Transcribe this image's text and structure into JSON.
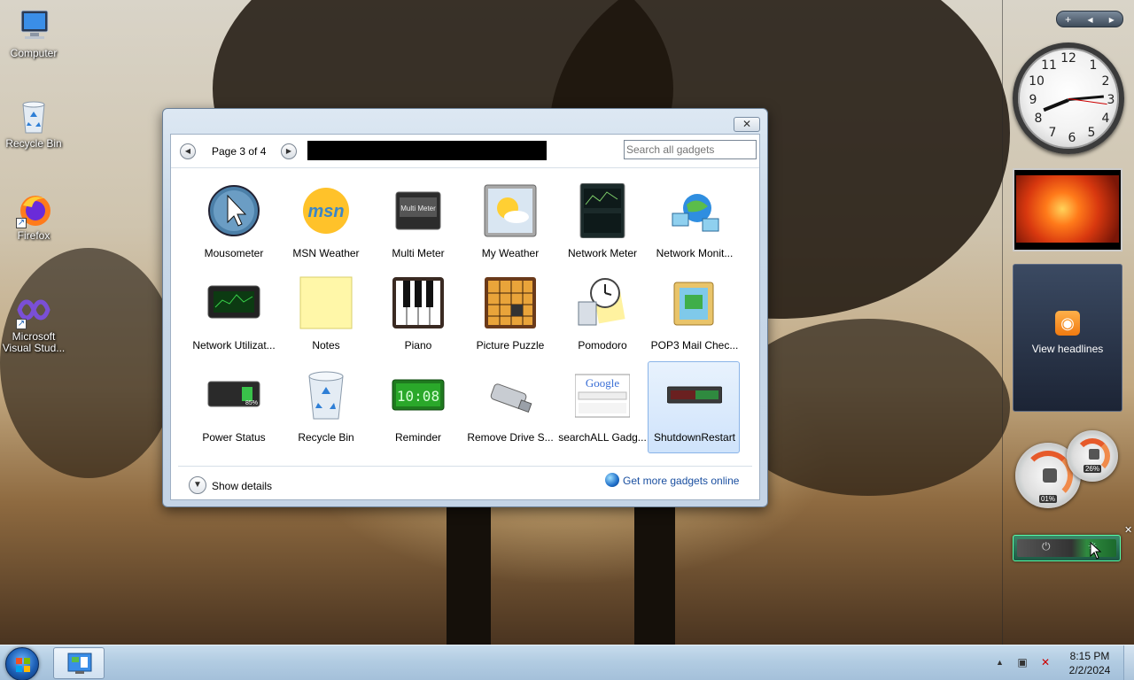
{
  "desktop": {
    "icons": [
      {
        "label": "Computer",
        "icon": "computer-icon"
      },
      {
        "label": "Recycle Bin",
        "icon": "recycle-bin-icon"
      },
      {
        "label": "Firefox",
        "icon": "firefox-icon"
      },
      {
        "label": "Microsoft Visual Stud...",
        "icon": "visual-studio-icon"
      }
    ]
  },
  "sidebar": {
    "controls": [
      "+",
      "◂",
      "▸"
    ],
    "clock": {
      "numbers": [
        "12",
        "1",
        "2",
        "3",
        "4",
        "5",
        "6",
        "7",
        "8",
        "9",
        "10",
        "11"
      ]
    },
    "feed_label": "View headlines",
    "cpu_readout": "01%",
    "mem_readout": "26%"
  },
  "gallery": {
    "close_glyph": "✕",
    "page_label": "Page 3 of 4",
    "search_placeholder": "Search all gadgets",
    "gadgets": [
      {
        "name": "Mousometer",
        "icon": "mousometer-icon"
      },
      {
        "name": "MSN Weather",
        "icon": "msn-weather-icon"
      },
      {
        "name": "Multi Meter",
        "icon": "multi-meter-icon"
      },
      {
        "name": "My Weather",
        "icon": "my-weather-icon"
      },
      {
        "name": "Network Meter",
        "icon": "network-meter-icon"
      },
      {
        "name": "Network Monit...",
        "icon": "network-monitor-icon"
      },
      {
        "name": "Network Utilizat...",
        "icon": "network-utilization-icon"
      },
      {
        "name": "Notes",
        "icon": "notes-icon"
      },
      {
        "name": "Piano",
        "icon": "piano-icon"
      },
      {
        "name": "Picture Puzzle",
        "icon": "picture-puzzle-icon"
      },
      {
        "name": "Pomodoro",
        "icon": "pomodoro-icon"
      },
      {
        "name": "POP3 Mail Chec...",
        "icon": "pop3-mail-icon"
      },
      {
        "name": "Power Status",
        "icon": "power-status-icon"
      },
      {
        "name": "Recycle Bin",
        "icon": "recycle-bin-gadget-icon"
      },
      {
        "name": "Reminder",
        "icon": "reminder-icon"
      },
      {
        "name": "Remove Drive S...",
        "icon": "remove-drive-icon"
      },
      {
        "name": "searchALL Gadg...",
        "icon": "searchall-icon"
      },
      {
        "name": "ShutdownRestart",
        "icon": "shutdown-restart-icon",
        "selected": true
      }
    ],
    "show_details_label": "Show details",
    "online_link_label": "Get more gadgets online"
  },
  "gadget_texts": {
    "multimeter": "Multi Meter",
    "reminder": "10:08",
    "google": "Google",
    "power": "85%"
  },
  "taskbar": {
    "time": "8:15 PM",
    "date": "2/2/2024"
  },
  "colors": {
    "link": "#1a4fa0",
    "selection": "#cfe3fb",
    "taskbar": "#b2cce2"
  }
}
